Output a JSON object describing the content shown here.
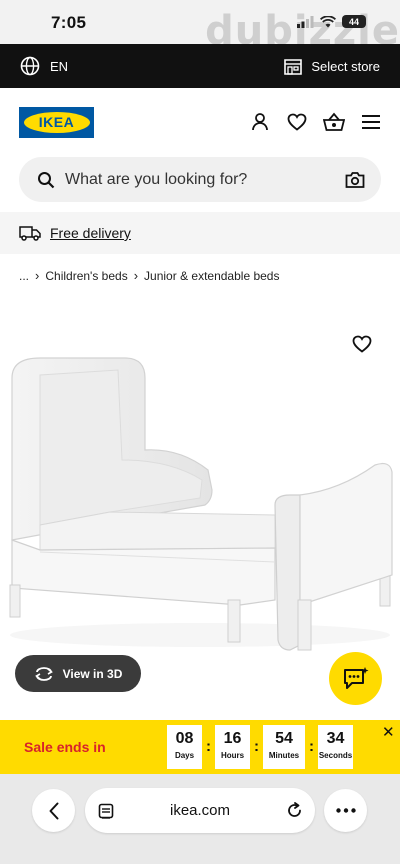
{
  "status_bar": {
    "time": "7:05",
    "battery": "44",
    "watermark": "dubizzle"
  },
  "topbar": {
    "language": "EN",
    "store_label": "Select store"
  },
  "header": {
    "logo_text": "IKEA"
  },
  "search": {
    "placeholder": "What are you looking for?"
  },
  "delivery": {
    "label": "Free delivery"
  },
  "breadcrumb": {
    "ellipsis": "...",
    "items": [
      "Children's beds",
      "Junior & extendable beds"
    ]
  },
  "product": {
    "view_3d_label": "View in 3D"
  },
  "sale": {
    "label": "Sale ends in",
    "countdown": [
      {
        "value": "08",
        "unit": "Days"
      },
      {
        "value": "16",
        "unit": "Hours"
      },
      {
        "value": "54",
        "unit": "Minutes"
      },
      {
        "value": "34",
        "unit": "Seconds"
      }
    ],
    "close_symbol": "✕"
  },
  "browser": {
    "url": "ikea.com"
  },
  "colors": {
    "ikea_blue": "#0058a3",
    "ikea_yellow": "#ffdb00",
    "sale_red": "#d8232a"
  }
}
